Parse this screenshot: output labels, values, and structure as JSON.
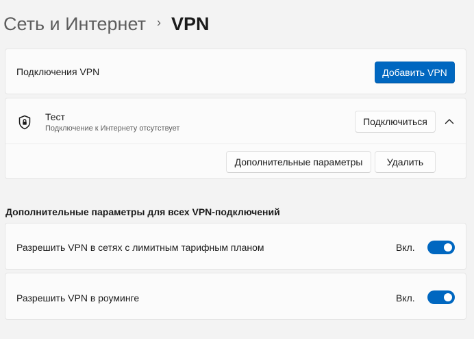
{
  "breadcrumb": {
    "parent": "Сеть и Интернет",
    "separator": "›",
    "current": "VPN"
  },
  "vpn_connections": {
    "label": "Подключения VPN",
    "add_button": "Добавить VPN"
  },
  "vpn_profile": {
    "icon": "shield-icon",
    "name": "Тест",
    "status": "Подключение к Интернету отсутствует",
    "connect_button": "Подключиться",
    "expanded": true,
    "advanced_button": "Дополнительные параметры",
    "remove_button": "Удалить"
  },
  "advanced_section": {
    "title": "Дополнительные параметры для всех VPN-подключений",
    "settings": [
      {
        "label": "Разрешить VPN в сетях с лимитным тарифным планом",
        "state": "Вкл.",
        "on": true
      },
      {
        "label": "Разрешить VPN в роуминге",
        "state": "Вкл.",
        "on": true
      }
    ]
  },
  "colors": {
    "accent": "#0067c0",
    "background": "#f3f3f3",
    "card": "#fbfbfb"
  }
}
